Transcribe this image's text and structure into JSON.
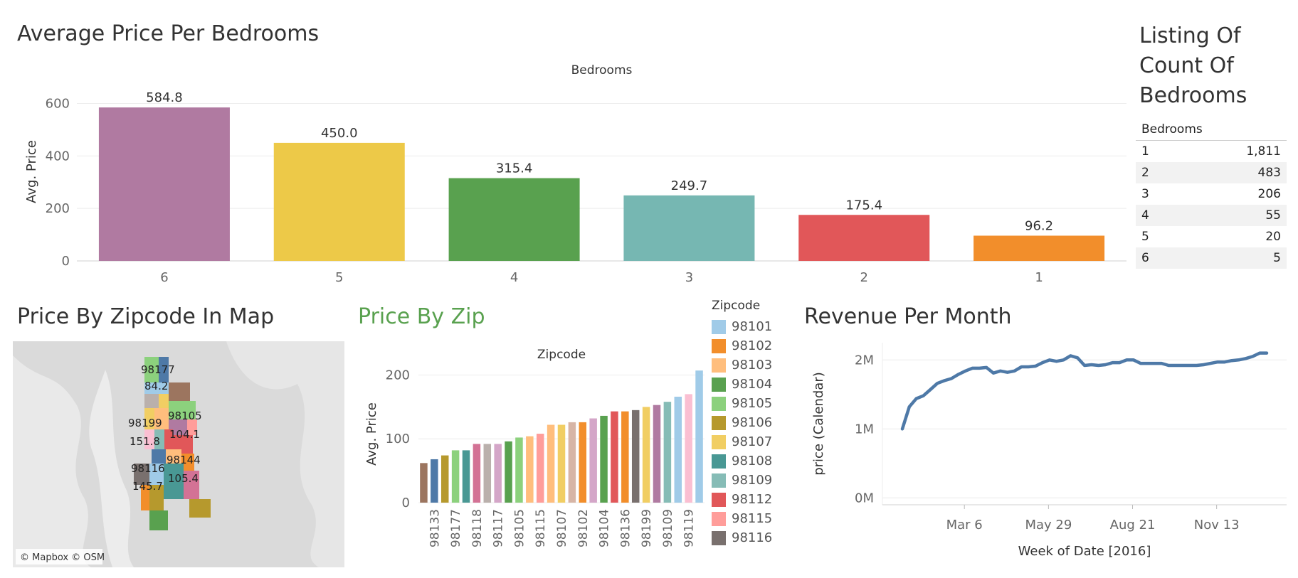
{
  "titles": {
    "bedrooms_chart": "Average Price Per Bedrooms",
    "listing_table": [
      "Listing Of",
      "Count Of",
      "Bedrooms"
    ],
    "map": "Price By Zipcode In Map",
    "zip_chart": "Price By Zip",
    "revenue": "Revenue Per Month"
  },
  "colors": {
    "zip_title": "#59a14f",
    "line": "#4e79a7"
  },
  "chart_data": [
    {
      "type": "bar",
      "title": "Average Price Per Bedrooms",
      "xlabel": "Bedrooms",
      "ylabel": "Avg. Price",
      "ylim": [
        0,
        680
      ],
      "yticks": [
        0,
        200,
        400,
        600
      ],
      "categories": [
        "6",
        "5",
        "4",
        "3",
        "2",
        "1"
      ],
      "values": [
        584.8,
        450.0,
        315.4,
        249.7,
        175.4,
        96.2
      ],
      "labels": [
        "584.8",
        "450.0",
        "315.4",
        "249.7",
        "175.4",
        "96.2"
      ],
      "colors": [
        "#b07aa1",
        "#edc948",
        "#59a14f",
        "#76b7b2",
        "#e15759",
        "#f28e2b"
      ],
      "grid": true
    },
    {
      "type": "table",
      "title": "Listing Of Count Of Bedrooms",
      "columns": [
        "Bedrooms",
        ""
      ],
      "rows": [
        [
          "1",
          "1,811"
        ],
        [
          "2",
          "483"
        ],
        [
          "3",
          "206"
        ],
        [
          "4",
          "55"
        ],
        [
          "5",
          "20"
        ],
        [
          "6",
          "5"
        ]
      ]
    },
    {
      "type": "bar",
      "title": "Price By Zip",
      "xlabel": "Zipcode",
      "ylabel": "Avg. Price",
      "ylim": [
        0,
        215
      ],
      "yticks": [
        0,
        100,
        200
      ],
      "values": [
        62,
        68,
        74,
        82,
        82,
        92,
        92,
        92,
        96,
        102,
        104,
        108,
        122,
        122,
        126,
        126,
        132,
        136,
        143,
        143,
        145,
        150,
        153,
        158,
        166,
        170,
        207
      ],
      "colors": [
        "#9c755f",
        "#4e79a7",
        "#b6992d",
        "#8cd17d",
        "#499894",
        "#d37295",
        "#bab0ac",
        "#d4a6c8",
        "#59a14f",
        "#8cd17d",
        "#ffbe7d",
        "#ff9d9a",
        "#ffbe7d",
        "#f1ce63",
        "#d7b5a6",
        "#f28e2b",
        "#d4a6c8",
        "#59a14f",
        "#e15759",
        "#f28e2b",
        "#79706e",
        "#f1ce63",
        "#b07aa1",
        "#86bcb6",
        "#a0cbe8",
        "#fabfd2",
        "#a0cbe8"
      ],
      "tick_labels": [
        "98133",
        "98177",
        "98118",
        "98117",
        "98105",
        "98115",
        "98107",
        "98102",
        "98104",
        "98136",
        "98199",
        "98109",
        "98119"
      ],
      "tick_bar_index": [
        1,
        3,
        5,
        7,
        9,
        11,
        13,
        15,
        17,
        19,
        21,
        23,
        25
      ],
      "legend_title": "Zipcode",
      "legend": [
        {
          "label": "98101",
          "color": "#a0cbe8"
        },
        {
          "label": "98102",
          "color": "#f28e2b"
        },
        {
          "label": "98103",
          "color": "#ffbe7d"
        },
        {
          "label": "98104",
          "color": "#59a14f"
        },
        {
          "label": "98105",
          "color": "#8cd17d"
        },
        {
          "label": "98106",
          "color": "#b6992d"
        },
        {
          "label": "98107",
          "color": "#f1ce63"
        },
        {
          "label": "98108",
          "color": "#499894"
        },
        {
          "label": "98109",
          "color": "#86bcb6"
        },
        {
          "label": "98112",
          "color": "#e15759"
        },
        {
          "label": "98115",
          "color": "#ff9d9a"
        },
        {
          "label": "98116",
          "color": "#79706e"
        }
      ]
    },
    {
      "type": "line",
      "title": "Revenue Per Month",
      "xlabel": "Week of Date [2016]",
      "ylabel": "price (Calendar)",
      "yticks": [
        {
          "v": 0,
          "label": "0M"
        },
        {
          "v": 1000000,
          "label": "1M"
        },
        {
          "v": 2000000,
          "label": "2M"
        }
      ],
      "ylim": [
        -100000,
        2250000
      ],
      "xlim": [
        "2016-01-04",
        "2017-01-02"
      ],
      "xticks": [
        {
          "date": "2016-03-06",
          "label": "Mar 6"
        },
        {
          "date": "2016-05-29",
          "label": "May 29"
        },
        {
          "date": "2016-08-21",
          "label": "Aug 21"
        },
        {
          "date": "2016-11-13",
          "label": "Nov 13"
        }
      ],
      "x": [
        "2016-01-04",
        "2016-01-11",
        "2016-01-18",
        "2016-01-25",
        "2016-02-01",
        "2016-02-08",
        "2016-02-15",
        "2016-02-22",
        "2016-02-29",
        "2016-03-07",
        "2016-03-14",
        "2016-03-21",
        "2016-03-28",
        "2016-04-04",
        "2016-04-11",
        "2016-04-18",
        "2016-04-25",
        "2016-05-02",
        "2016-05-09",
        "2016-05-16",
        "2016-05-23",
        "2016-05-30",
        "2016-06-06",
        "2016-06-13",
        "2016-06-20",
        "2016-06-27",
        "2016-07-04",
        "2016-07-11",
        "2016-07-18",
        "2016-07-25",
        "2016-08-01",
        "2016-08-08",
        "2016-08-15",
        "2016-08-22",
        "2016-08-29",
        "2016-09-05",
        "2016-09-12",
        "2016-09-19",
        "2016-09-26",
        "2016-10-03",
        "2016-10-10",
        "2016-10-17",
        "2016-10-24",
        "2016-10-31",
        "2016-11-07",
        "2016-11-14",
        "2016-11-21",
        "2016-11-28",
        "2016-12-05",
        "2016-12-12",
        "2016-12-19",
        "2016-12-26",
        "2017-01-02"
      ],
      "y": [
        1000000,
        1320000,
        1440000,
        1480000,
        1570000,
        1660000,
        1700000,
        1730000,
        1790000,
        1840000,
        1880000,
        1880000,
        1890000,
        1810000,
        1840000,
        1820000,
        1840000,
        1900000,
        1900000,
        1910000,
        1960000,
        2000000,
        1980000,
        2000000,
        2060000,
        2030000,
        1920000,
        1930000,
        1920000,
        1930000,
        1960000,
        1960000,
        2000000,
        2000000,
        1950000,
        1950000,
        1950000,
        1950000,
        1920000,
        1920000,
        1920000,
        1920000,
        1920000,
        1930000,
        1950000,
        1970000,
        1970000,
        1990000,
        2000000,
        2020000,
        2050000,
        2100000,
        2100000
      ]
    }
  ],
  "map": {
    "zip_labels": [
      "98177",
      "98105",
      "98199",
      "98144",
      "98116"
    ],
    "value_labels": [
      "84.2",
      "104.1",
      "151.8",
      "105.4",
      "145.7"
    ],
    "attribution": "© Mapbox © OSM"
  }
}
